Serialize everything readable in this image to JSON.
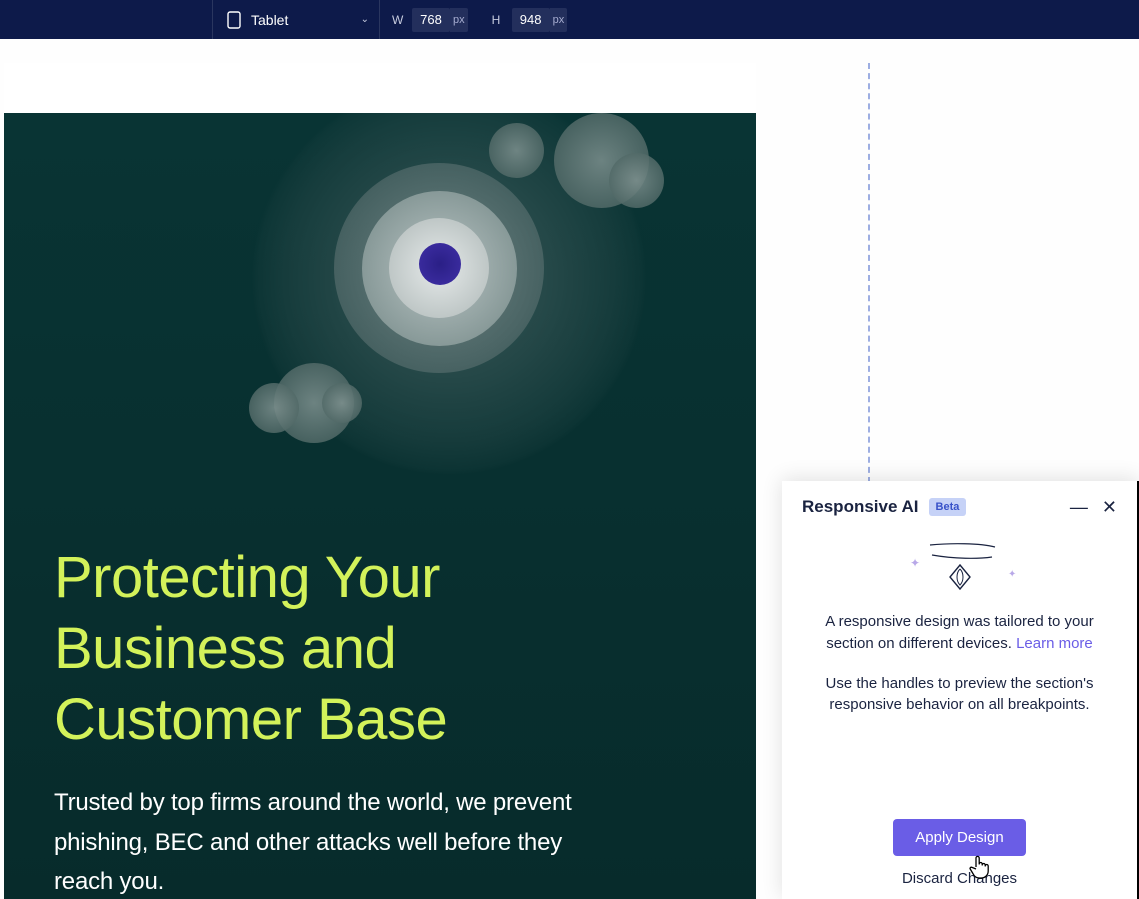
{
  "toolbar": {
    "device_label": "Tablet",
    "w_label": "W",
    "w_value": "768",
    "w_unit": "px",
    "h_label": "H",
    "h_value": "948",
    "h_unit": "px"
  },
  "hero": {
    "headline": "Protecting Your Business and Customer Base",
    "subhead": "Trusted by top firms around the world, we prevent phishing, BEC and other attacks well before they reach you."
  },
  "panel": {
    "title": "Responsive AI",
    "badge": "Beta",
    "msg1_prefix": "A responsive design was tailored to your section on different devices. ",
    "learn_more": "Learn more",
    "msg2": "Use the handles to preview the section's responsive behavior on all breakpoints.",
    "apply": "Apply Design",
    "discard": "Discard Changes"
  }
}
